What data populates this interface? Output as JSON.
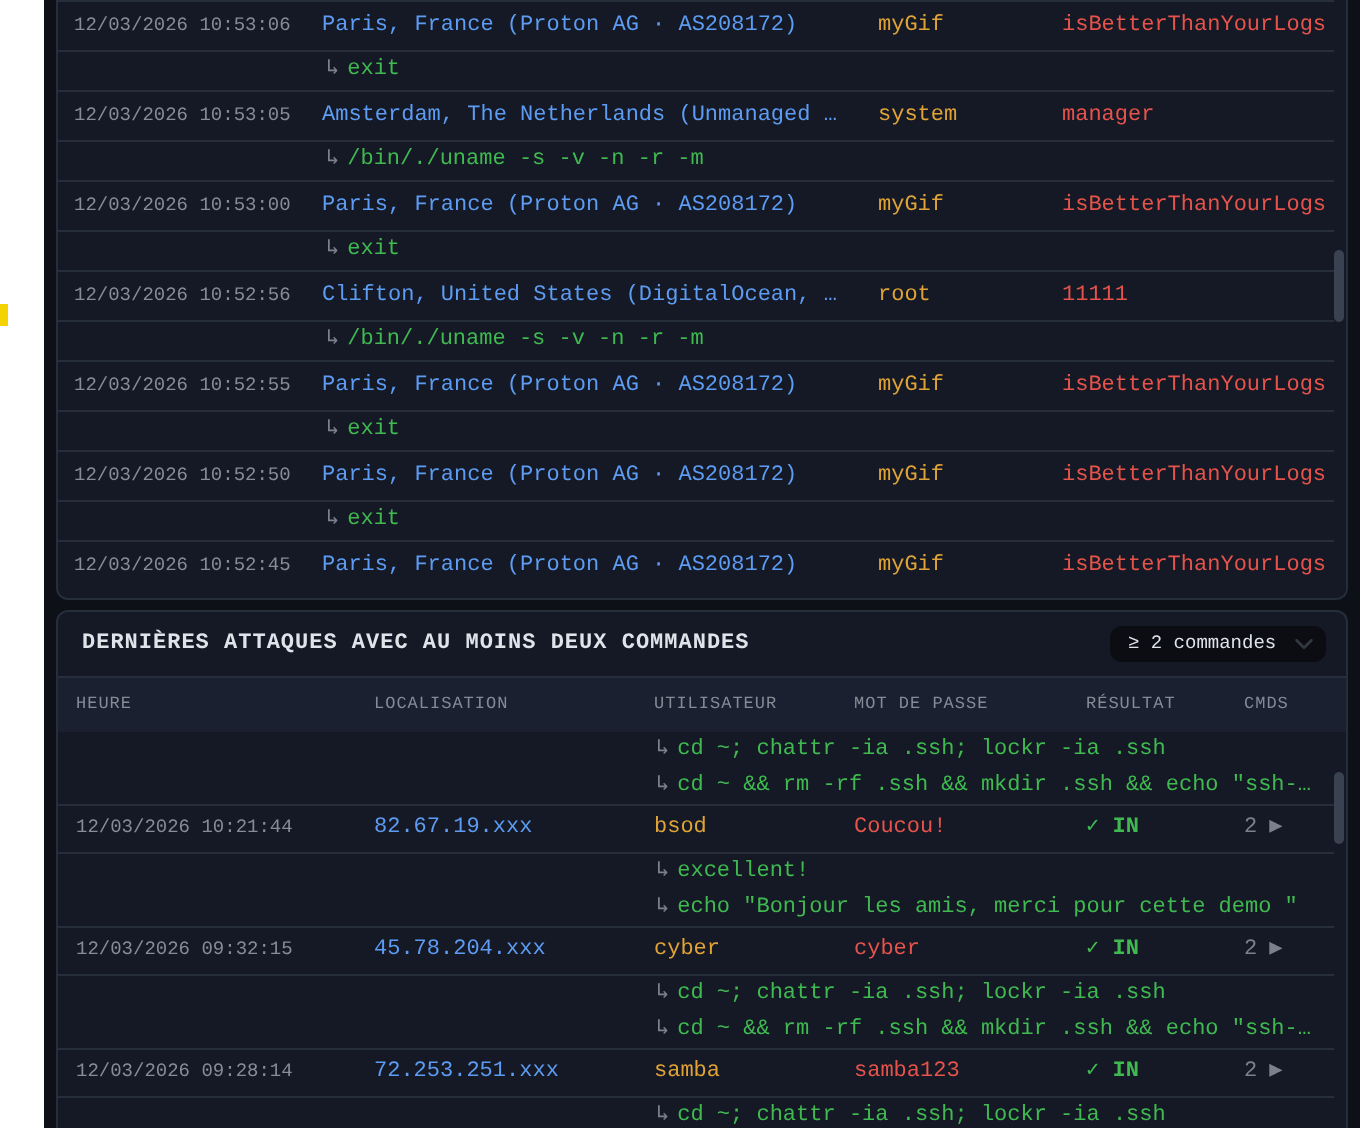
{
  "login_log": {
    "rows": [
      {
        "kind": "login",
        "time": "12/03/2026 10:53:06",
        "location": "Paris, France (Proton AG · AS208172)",
        "user": "myGif",
        "password": "isBetterThanYourLogs"
      },
      {
        "kind": "command",
        "prefix": "↳",
        "command": "exit"
      },
      {
        "kind": "login",
        "time": "12/03/2026 10:53:05",
        "location": "Amsterdam, The Netherlands (Unmanaged …",
        "user": "system",
        "password": "manager"
      },
      {
        "kind": "command",
        "prefix": "↳",
        "command": "/bin/./uname -s -v -n -r -m"
      },
      {
        "kind": "login",
        "time": "12/03/2026 10:53:00",
        "location": "Paris, France (Proton AG · AS208172)",
        "user": "myGif",
        "password": "isBetterThanYourLogs"
      },
      {
        "kind": "command",
        "prefix": "↳",
        "command": "exit"
      },
      {
        "kind": "login",
        "time": "12/03/2026 10:52:56",
        "location": "Clifton, United States (DigitalOcean, …",
        "user": "root",
        "password": "11111"
      },
      {
        "kind": "command",
        "prefix": "↳",
        "command": "/bin/./uname -s -v -n -r -m"
      },
      {
        "kind": "login",
        "time": "12/03/2026 10:52:55",
        "location": "Paris, France (Proton AG · AS208172)",
        "user": "myGif",
        "password": "isBetterThanYourLogs"
      },
      {
        "kind": "command",
        "prefix": "↳",
        "command": "exit"
      },
      {
        "kind": "login",
        "time": "12/03/2026 10:52:50",
        "location": "Paris, France (Proton AG · AS208172)",
        "user": "myGif",
        "password": "isBetterThanYourLogs"
      },
      {
        "kind": "command",
        "prefix": "↳",
        "command": "exit"
      },
      {
        "kind": "login",
        "time": "12/03/2026 10:52:45",
        "location": "Paris, France (Proton AG · AS208172)",
        "user": "myGif",
        "password": "isBetterThanYourLogs"
      }
    ]
  },
  "multi_command_attacks": {
    "title": "DERNIÈRES ATTAQUES AVEC AU MOINS DEUX COMMANDES",
    "filter": {
      "value": "≥ 2 commandes"
    },
    "columns": [
      "HEURE",
      "LOCALISATION",
      "UTILISATEUR",
      "MOT DE PASSE",
      "RÉSULTAT",
      "CMDS"
    ],
    "rows": [
      {
        "kind": "command",
        "prefix": "↳",
        "command": "cd ~; chattr -ia .ssh; lockr -ia .ssh"
      },
      {
        "kind": "command",
        "prefix": "↳",
        "command": "cd ~ && rm -rf .ssh && mkdir .ssh && echo \"ssh-…"
      },
      {
        "kind": "attack",
        "time": "12/03/2026 10:21:44",
        "location": "82.67.19.xxx",
        "user": "bsod",
        "password": "Coucou!",
        "result": "✓ IN",
        "cmds": "2",
        "expand": "▶"
      },
      {
        "kind": "command",
        "prefix": "↳",
        "command": "excellent!"
      },
      {
        "kind": "command",
        "prefix": "↳",
        "command": "echo \"Bonjour les amis, merci pour cette demo \""
      },
      {
        "kind": "attack",
        "time": "12/03/2026 09:32:15",
        "location": "45.78.204.xxx",
        "user": "cyber",
        "password": "cyber",
        "result": "✓ IN",
        "cmds": "2",
        "expand": "▶"
      },
      {
        "kind": "command",
        "prefix": "↳",
        "command": "cd ~; chattr -ia .ssh; lockr -ia .ssh"
      },
      {
        "kind": "command",
        "prefix": "↳",
        "command": "cd ~ && rm -rf .ssh && mkdir .ssh && echo \"ssh-…"
      },
      {
        "kind": "attack",
        "time": "12/03/2026 09:28:14",
        "location": "72.253.251.xxx",
        "user": "samba",
        "password": "samba123",
        "result": "✓ IN",
        "cmds": "2",
        "expand": "▶"
      },
      {
        "kind": "command",
        "prefix": "↳",
        "command": "cd ~; chattr -ia .ssh; lockr -ia .ssh"
      }
    ]
  }
}
